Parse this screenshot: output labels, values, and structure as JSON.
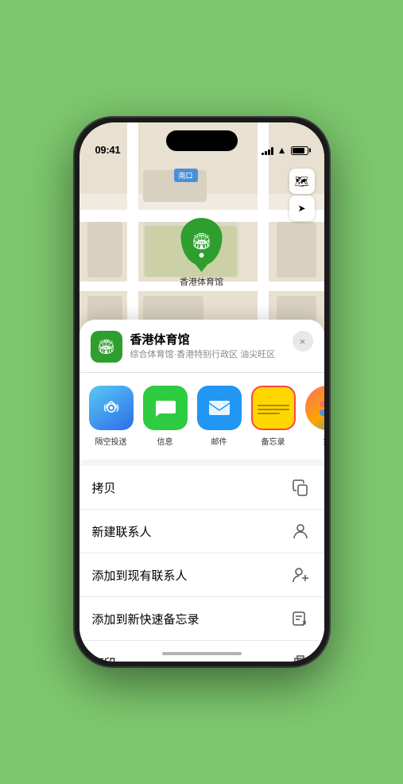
{
  "status": {
    "time": "09:41",
    "location_arrow": "▶"
  },
  "map": {
    "label": "南口",
    "pin_label": "香港体育馆"
  },
  "venue": {
    "name": "香港体育馆",
    "subtitle": "综合体育馆·香港特别行政区 油尖旺区",
    "close_label": "×"
  },
  "share_apps": [
    {
      "id": "airdrop",
      "label": "隔空投送"
    },
    {
      "id": "messages",
      "label": "信息"
    },
    {
      "id": "mail",
      "label": "邮件"
    },
    {
      "id": "notes",
      "label": "备忘录"
    },
    {
      "id": "more",
      "label": "提"
    }
  ],
  "actions": [
    {
      "label": "拷贝",
      "icon": "copy"
    },
    {
      "label": "新建联系人",
      "icon": "person"
    },
    {
      "label": "添加到现有联系人",
      "icon": "person-add"
    },
    {
      "label": "添加到新快速备忘录",
      "icon": "note"
    },
    {
      "label": "打印",
      "icon": "print"
    }
  ]
}
